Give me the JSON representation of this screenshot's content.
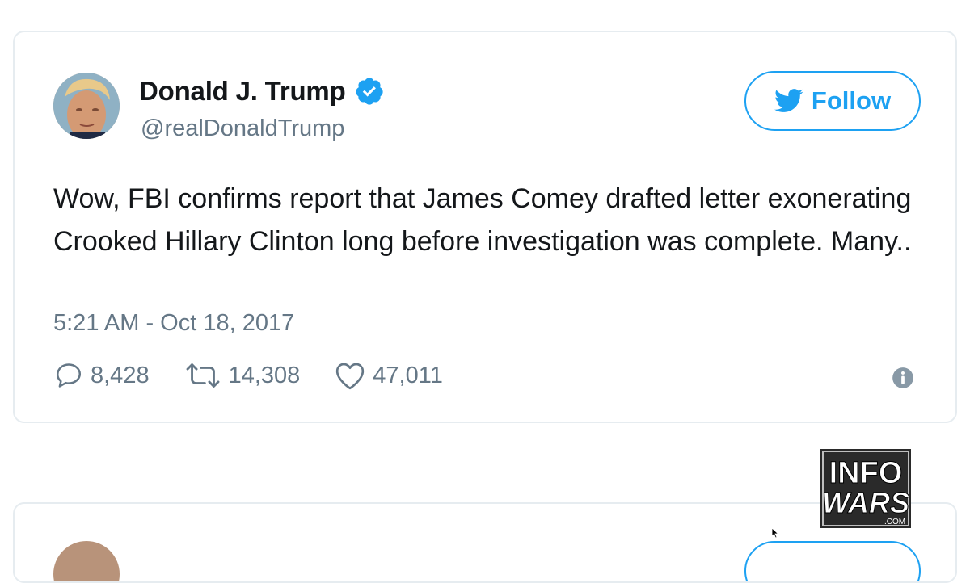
{
  "tweet": {
    "display_name": "Donald J. Trump",
    "verified_icon": "verified-badge-icon",
    "handle": "@realDonaldTrump",
    "follow_label": "Follow",
    "follow_icon": "twitter-bird-icon",
    "text": "Wow, FBI confirms report that James Comey drafted letter exonerating Crooked Hillary Clinton long before investigation was complete. Many..",
    "timestamp": "5:21 AM - Oct 18, 2017",
    "actions": {
      "replies": "8,428",
      "retweets": "14,308",
      "likes": "47,011"
    },
    "info_icon": "info-icon"
  },
  "watermark": {
    "line1": "INFO",
    "line2": "WARS",
    "line3": ".COM"
  },
  "colors": {
    "accent": "#1da1f2",
    "text": "#14171a",
    "secondary": "#657786",
    "border": "#e6ecf0"
  }
}
